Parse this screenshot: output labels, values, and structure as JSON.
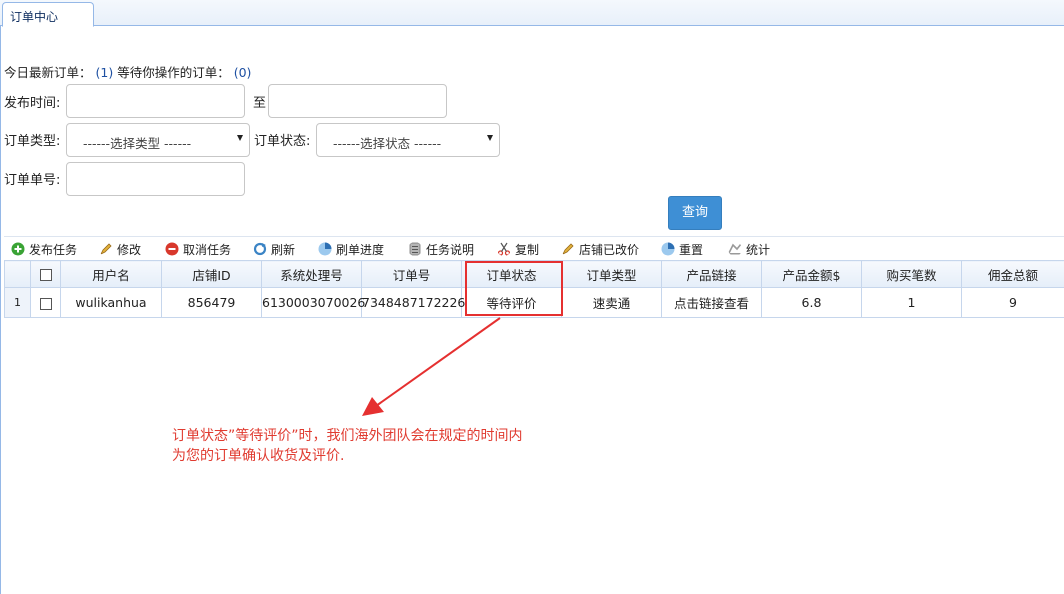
{
  "tab": {
    "title": "订单中心"
  },
  "summary": {
    "today_label": "今日最新订单：",
    "today_count": "(1)",
    "pending_label": "等待你操作的订单：",
    "pending_count": "(0)"
  },
  "form": {
    "publish_time_label": "发布时间:",
    "to_label": "至",
    "start_value": "",
    "end_value": "",
    "type_label": "订单类型:",
    "type_selected": "------选择类型 ------",
    "status_label": "订单状态:",
    "status_selected": "------选择状态 ------",
    "order_no_label": "订单单号:",
    "order_no_value": "",
    "query_button": "查询"
  },
  "toolbar": {
    "items": [
      {
        "label": "发布任务",
        "icon": "add-icon",
        "color": "#3aa335"
      },
      {
        "label": "修改",
        "icon": "pencil-icon",
        "color": "#c89a32"
      },
      {
        "label": "取消任务",
        "icon": "cancel-icon",
        "color": "#d8382c"
      },
      {
        "label": "刷新",
        "icon": "refresh-icon",
        "color": "#3b84c5"
      },
      {
        "label": "刷单进度",
        "icon": "progress-icon",
        "color": "#4f9ad6"
      },
      {
        "label": "任务说明",
        "icon": "document-icon",
        "color": "#8a8a8a"
      },
      {
        "label": "复制",
        "icon": "scissors-icon",
        "color": "#d8382c"
      },
      {
        "label": "店铺已改价",
        "icon": "pencil-icon",
        "color": "#c89a32"
      },
      {
        "label": "重置",
        "icon": "reset-icon",
        "color": "#4f9ad6"
      },
      {
        "label": "统计",
        "icon": "stats-icon",
        "color": "#9a9a9a"
      }
    ]
  },
  "grid": {
    "columns": [
      "用户名",
      "店铺ID",
      "系统处理号",
      "订单号",
      "订单状态",
      "订单类型",
      "产品链接",
      "产品金额$",
      "购买笔数",
      "佣金总额"
    ],
    "rows": [
      {
        "row_number": "1",
        "username": "wulikanhua",
        "shop_id": "856479",
        "system_no": "6130003070026",
        "order_no": "7348487172226",
        "status": "等待评价",
        "order_type": "速卖通",
        "product_link": "点击链接查看",
        "amount": "6.8",
        "count": "1",
        "commission": "9"
      }
    ]
  },
  "annotation": {
    "line1": "订单状态”等待评价”时，我们海外团队会在规定的时间内",
    "line2": "为您的订单确认收货及评价."
  },
  "colors": {
    "accent": "#3e8fd5",
    "annotation": "#e03b30",
    "link_red": "#d62121"
  }
}
